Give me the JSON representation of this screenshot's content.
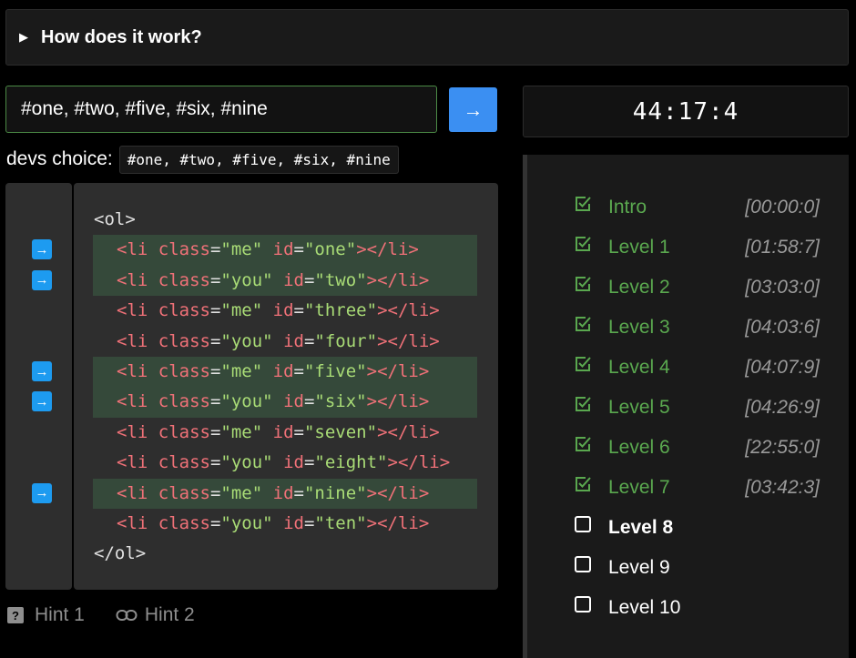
{
  "details": {
    "title": "How does it work?"
  },
  "selector": {
    "value": "#one, #two, #five, #six, #nine",
    "submit_icon": "arrow-right-icon"
  },
  "timer": "44:17:4",
  "devs_choice": {
    "label": "devs choice:",
    "code": "#one, #two, #five, #six, #nine"
  },
  "code": {
    "open": "<ol>",
    "close": "</ol>",
    "items": [
      {
        "cls": "me",
        "id": "one",
        "matched": true
      },
      {
        "cls": "you",
        "id": "two",
        "matched": true
      },
      {
        "cls": "me",
        "id": "three",
        "matched": false
      },
      {
        "cls": "you",
        "id": "four",
        "matched": false
      },
      {
        "cls": "me",
        "id": "five",
        "matched": true
      },
      {
        "cls": "you",
        "id": "six",
        "matched": true
      },
      {
        "cls": "me",
        "id": "seven",
        "matched": false
      },
      {
        "cls": "you",
        "id": "eight",
        "matched": false
      },
      {
        "cls": "me",
        "id": "nine",
        "matched": true
      },
      {
        "cls": "you",
        "id": "ten",
        "matched": false
      }
    ]
  },
  "hints": [
    {
      "label": "Hint 1",
      "icon": "question-icon"
    },
    {
      "label": "Hint 2",
      "icon": "link-icon"
    }
  ],
  "levels": [
    {
      "name": "Intro",
      "time": "[00:00:0]",
      "done": true
    },
    {
      "name": "Level 1",
      "time": "[01:58:7]",
      "done": true
    },
    {
      "name": "Level 2",
      "time": "[03:03:0]",
      "done": true
    },
    {
      "name": "Level 3",
      "time": "[04:03:6]",
      "done": true
    },
    {
      "name": "Level 4",
      "time": "[04:07:9]",
      "done": true
    },
    {
      "name": "Level 5",
      "time": "[04:26:9]",
      "done": true
    },
    {
      "name": "Level 6",
      "time": "[22:55:0]",
      "done": true
    },
    {
      "name": "Level 7",
      "time": "[03:42:3]",
      "done": true
    },
    {
      "name": "Level 8",
      "time": "",
      "done": false,
      "current": true
    },
    {
      "name": "Level 9",
      "time": "",
      "done": false
    },
    {
      "name": "Level 10",
      "time": "",
      "done": false
    }
  ],
  "colors": {
    "done": "#5aa84f",
    "accent": "#3b8ff2",
    "marker": "#1d9bf0",
    "highlight": "#35493a"
  }
}
